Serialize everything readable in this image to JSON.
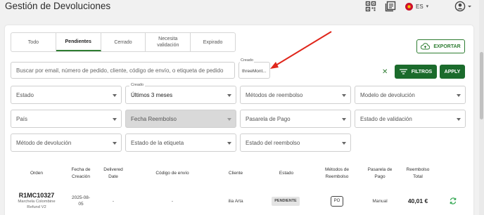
{
  "header": {
    "title": "Gestión de Devoluciones",
    "language": "ES"
  },
  "tabs": [
    {
      "label": "Todo"
    },
    {
      "label": "Pendientes"
    },
    {
      "label": "Cerrado"
    },
    {
      "label": "Necesita validación"
    },
    {
      "label": "Expirado"
    }
  ],
  "export_label": "EXPORTAR",
  "search": {
    "placeholder": "Buscar por email, número de pedido, cliente, código de envío, o etiqueta de pedido"
  },
  "created_filter": {
    "label": "Creado",
    "value": "threeMont..."
  },
  "buttons": {
    "clear": "✕",
    "filters": "FILTROS",
    "apply": "APPLY"
  },
  "filters": {
    "estado": "Estado",
    "creado_label": "Creado",
    "creado_value": "Últimos 3 meses",
    "metodos_reembolso": "Métodos de reembolso",
    "modelo_devolucion": "Modelo de devolución",
    "pais": "País",
    "fecha_reembolso": "Fecha Reembolso",
    "pasarela_pago": "Pasarela de Pago",
    "estado_validacion": "Estado de validación",
    "metodo_devolucion": "Método de devolución",
    "estado_etiqueta": "Estado de la etiqueta",
    "estado_reembolso": "Estado del reembolso"
  },
  "table": {
    "headers": {
      "orden": "Orden",
      "fecha_creacion": "Fecha de Creación",
      "delivered_date": "Delivered Date",
      "codigo_envio": "Código de envío",
      "cliente": "Cliente",
      "estado": "Estado",
      "metodos_reembolso": "Métodos de Reembolso",
      "pasarela_pago": "Pasarela de Pago",
      "reembolso_total": "Reembolso Total"
    },
    "rows": [
      {
        "order_id": "R1MC10327",
        "order_product": "Marchela Colombine Refund V2",
        "fecha": "2025-08-05",
        "delivered": "-",
        "codigo": "-",
        "cliente": "ilia Arta",
        "estado": "PENDIENTE",
        "metodo": "PO",
        "pasarela": "Manual",
        "total": "40,01 €"
      }
    ]
  },
  "colors": {
    "accent": "#1b6b2c",
    "accent_outline": "#2e7d32"
  }
}
